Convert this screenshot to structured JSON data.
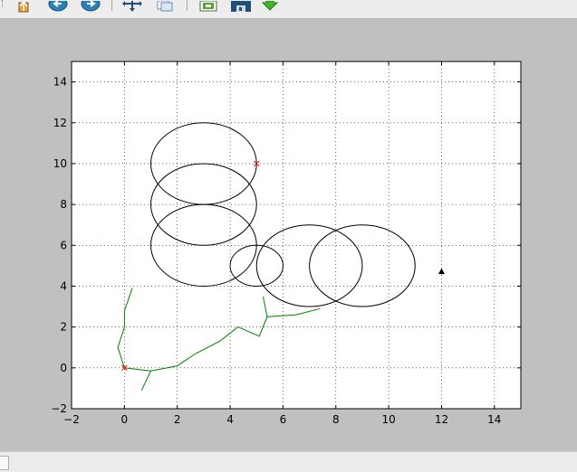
{
  "toolbar": {
    "buttons": [
      {
        "name": "home-icon",
        "label": "Home"
      },
      {
        "name": "back-arrow-icon",
        "label": "Back"
      },
      {
        "name": "forward-arrow-icon",
        "label": "Forward"
      },
      {
        "name": "pan-icon",
        "label": "Pan"
      },
      {
        "name": "zoom-icon",
        "label": "Zoom"
      },
      {
        "name": "subplots-icon",
        "label": "Configure subplots"
      },
      {
        "name": "save-icon",
        "label": "Save"
      },
      {
        "name": "download-arrow-icon",
        "label": "Export"
      }
    ]
  },
  "chart_data": {
    "type": "line",
    "title": "",
    "xlabel": "",
    "ylabel": "",
    "xlim": [
      -2,
      15
    ],
    "ylim": [
      -2,
      15
    ],
    "xticks": [
      -2,
      0,
      2,
      4,
      6,
      8,
      10,
      12,
      14
    ],
    "yticks": [
      -2,
      0,
      2,
      4,
      6,
      8,
      10,
      12,
      14
    ],
    "xtick_labels": [
      "−2",
      "0",
      "2",
      "4",
      "6",
      "8",
      "10",
      "12",
      "14"
    ],
    "ytick_labels": [
      "−2",
      "0",
      "2",
      "4",
      "6",
      "8",
      "10",
      "12",
      "14"
    ],
    "grid": true,
    "grid_style": "dotted",
    "ellipses": [
      {
        "cx": 3,
        "cy": 10,
        "rx": 2,
        "ry": 2
      },
      {
        "cx": 3,
        "cy": 8,
        "rx": 2,
        "ry": 2
      },
      {
        "cx": 3,
        "cy": 6,
        "rx": 2,
        "ry": 2
      },
      {
        "cx": 5,
        "cy": 5,
        "rx": 1,
        "ry": 1
      },
      {
        "cx": 7,
        "cy": 5,
        "rx": 2,
        "ry": 2
      },
      {
        "cx": 9,
        "cy": 5,
        "rx": 2,
        "ry": 2
      }
    ],
    "ellipse_color": "#000000",
    "series": [
      {
        "color": "#008000",
        "segments": [
          [
            [
              0.3,
              3.9
            ],
            [
              0.0,
              2.8
            ],
            [
              0.0,
              2.0
            ],
            [
              -0.25,
              1.0
            ],
            [
              0.0,
              0.0
            ],
            [
              1.0,
              -0.15
            ],
            [
              2.0,
              0.1
            ],
            [
              2.7,
              0.7
            ],
            [
              3.6,
              1.3
            ],
            [
              4.3,
              2.0
            ],
            [
              5.1,
              1.55
            ],
            [
              5.4,
              2.5
            ],
            [
              6.5,
              2.6
            ],
            [
              7.4,
              2.9
            ]
          ],
          [
            [
              0.65,
              -1.1
            ],
            [
              1.0,
              -0.15
            ]
          ],
          [
            [
              5.25,
              3.5
            ],
            [
              5.4,
              2.5
            ]
          ]
        ]
      }
    ],
    "markers": [
      {
        "x": 0,
        "y": 0,
        "symbol": "x",
        "color": "#ff0000"
      },
      {
        "x": 5,
        "y": 10,
        "symbol": "x",
        "color": "#ff0000"
      },
      {
        "x": 12,
        "y": 4.7,
        "symbol": "triangle",
        "color": "#000000"
      }
    ]
  }
}
